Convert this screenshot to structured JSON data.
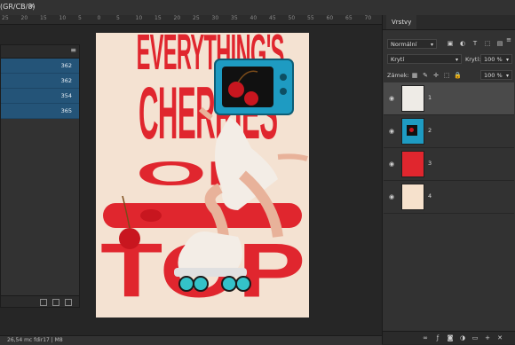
{
  "document": {
    "tab_title": "(GR/CB/8)",
    "close_glyph": "×"
  },
  "ruler": {
    "marks": [
      "25",
      "20",
      "15",
      "10",
      "5",
      "0",
      "5",
      "10",
      "15",
      "20",
      "25",
      "30",
      "35",
      "40",
      "45",
      "50",
      "55",
      "60",
      "65",
      "70"
    ]
  },
  "left_panel": {
    "menu_glyph": "≡",
    "rows": [
      "362",
      "362",
      "354",
      "365"
    ]
  },
  "status": {
    "text": "26,54 mc fdir17 | M8"
  },
  "poster": {
    "line1": "EVERYTHING'S",
    "line2": "CHERRIES",
    "line3": "ON",
    "line4": "TOP",
    "colors": {
      "background": "#f4e2d2",
      "red": "#e0262e",
      "tv": "#1e9bc2"
    }
  },
  "layers_panel": {
    "tab": "Vrstvy",
    "menu_glyph": "≡",
    "blend_mode": "Normální",
    "opacity_label": "Krytí:",
    "opacity_value": "100 %",
    "fill_value": "100 %",
    "kind_filter": "Krytí",
    "lock_label": "Zámek:",
    "layers": [
      {
        "name": "1",
        "color": "#eeebe6",
        "selected": true
      },
      {
        "name": "2",
        "color": "#1e9bc2",
        "selected": false
      },
      {
        "name": "3",
        "color": "#e0262e",
        "selected": false
      },
      {
        "name": "4",
        "color": "#f6e1cc",
        "selected": false
      }
    ],
    "footer_icons": [
      "link-icon",
      "fx-icon",
      "mask-icon",
      "adjustment-icon",
      "group-icon",
      "new-layer-icon",
      "trash-icon"
    ]
  }
}
